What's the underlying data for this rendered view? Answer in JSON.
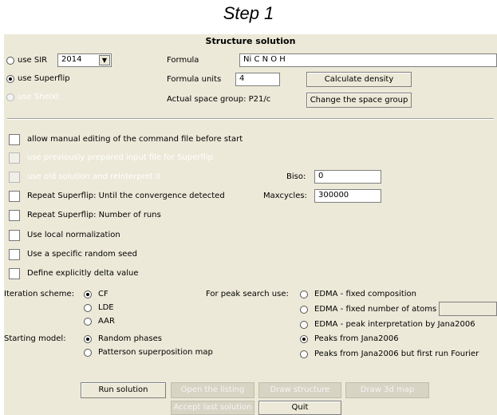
{
  "header": {
    "step_label": "Step 1"
  },
  "dialog": {
    "title": "Structure solution",
    "sir": {
      "label": "use SIR",
      "version": "2014",
      "selected": false
    },
    "superflip": {
      "label": "use Superflip",
      "selected": true
    },
    "shelxt": {
      "label": "use Shelxt",
      "selected": false,
      "disabled": true
    },
    "formula": {
      "label": "Formula",
      "value": "Ni C N O H"
    },
    "formula_units": {
      "label": "Formula units",
      "value": "4"
    },
    "space_group": {
      "label": "Actual space group: P21/c"
    },
    "calc_density_button": "Calculate density",
    "change_space_group_button": "Change the space group",
    "options": [
      {
        "label": "allow manual editing of the command file before start",
        "checked": false,
        "disabled": false
      },
      {
        "label": "use previously prepared input file for Superflip",
        "checked": false,
        "disabled": true
      },
      {
        "label": "use old solution and reinterpret it",
        "checked": false,
        "disabled": true
      },
      {
        "label": "Repeat Superflip: Until the convergence detected",
        "checked": false,
        "disabled": false
      },
      {
        "label": "Repeat Superflip: Number of runs",
        "checked": false,
        "disabled": false
      },
      {
        "label": "Use local normalization",
        "checked": false,
        "disabled": false
      },
      {
        "label": "Use a specific random seed",
        "checked": false,
        "disabled": false
      },
      {
        "label": "Define explicitly delta value",
        "checked": false,
        "disabled": false
      }
    ],
    "biso": {
      "label": "Biso:",
      "value": "0"
    },
    "maxcycles": {
      "label": "Maxcycles:",
      "value": "300000"
    },
    "iteration_scheme": {
      "label": "Iteration scheme:",
      "options": [
        {
          "label": "CF",
          "selected": true
        },
        {
          "label": "LDE",
          "selected": false
        },
        {
          "label": "AAR",
          "selected": false
        }
      ]
    },
    "starting_model": {
      "label": "Starting model:",
      "options": [
        {
          "label": "Random phases",
          "selected": true
        },
        {
          "label": "Patterson superposition map",
          "selected": false
        }
      ]
    },
    "peak_search": {
      "label": "For peak search use:",
      "options": [
        {
          "label": "EDMA - fixed composition",
          "selected": false
        },
        {
          "label": "EDMA - fixed number of atoms",
          "selected": false
        },
        {
          "label": "EDMA - peak interpretation by Jana2006",
          "selected": false
        },
        {
          "label": "Peaks from Jana2006",
          "selected": true
        },
        {
          "label": "Peaks from Jana2006 but first run Fourier",
          "selected": false
        }
      ],
      "atoms_value": ""
    },
    "buttons": {
      "run_solution": "Run solution",
      "open_listing": "Open the listing",
      "draw_structure": "Draw structure",
      "draw_3d_map": "Draw 3d map",
      "accept_last_solution": "Accept last solution",
      "quit": "Quit"
    }
  }
}
